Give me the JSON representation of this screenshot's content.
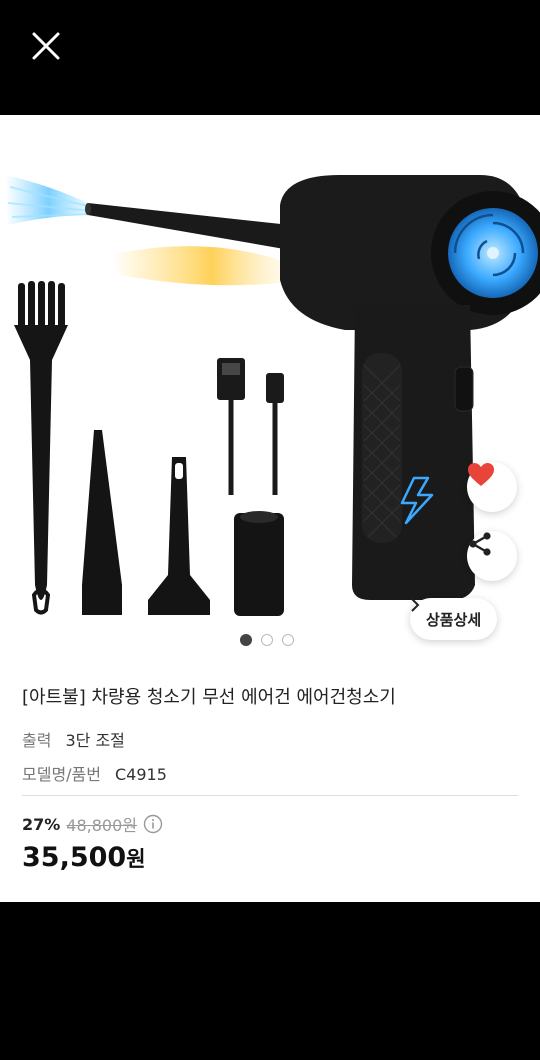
{
  "header": {
    "close_icon": "close-icon"
  },
  "product": {
    "title": "[아트불] 차량용 청소기 무선 에어건 에어건청소기",
    "specs": [
      {
        "label": "출력",
        "value": "3단 조절"
      },
      {
        "label": "모델명/품번",
        "value": "C4915"
      }
    ],
    "discount_rate": "27%",
    "original_price": "48,800원",
    "price_number": "35,500",
    "price_unit": "원"
  },
  "carousel": {
    "total": 3,
    "active_index": 0
  },
  "actions": {
    "detail_label": "상품상세",
    "like_icon": "heart-icon",
    "share_icon": "share-icon"
  },
  "colors": {
    "heart": "#e8443a",
    "accent_blue": "#3aa9ff",
    "dark": "#1b1b1b"
  }
}
